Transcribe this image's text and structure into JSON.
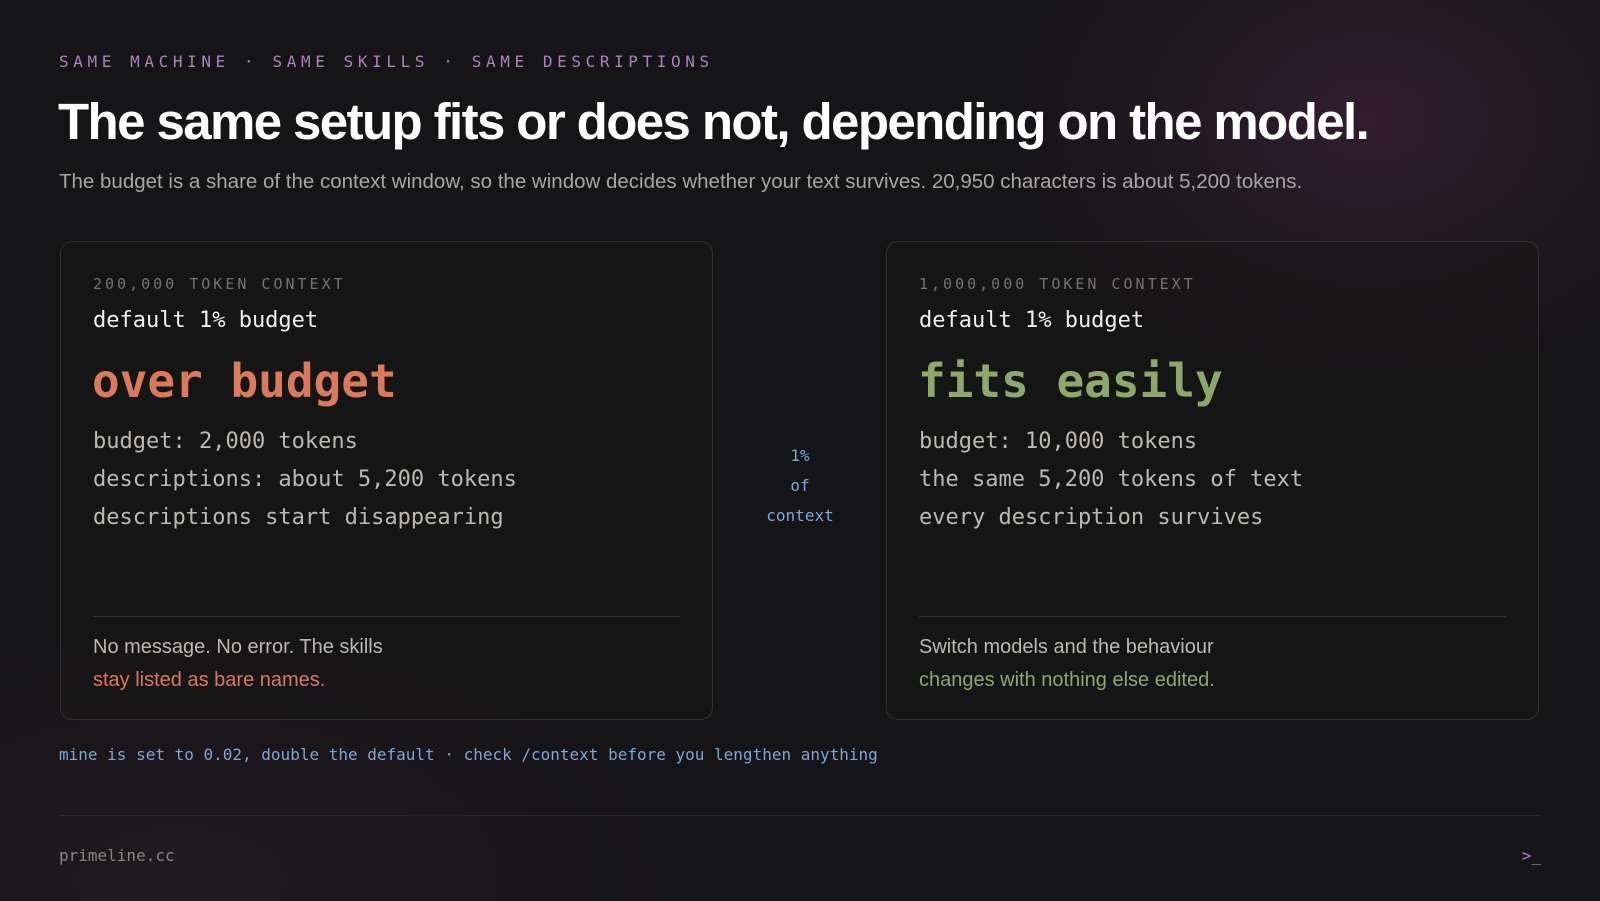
{
  "kicker": "SAME MACHINE · SAME SKILLS · SAME DESCRIPTIONS",
  "headline": "The same setup fits or does not, depending on the model.",
  "subtitle": "The budget is a share of the context window, so the window decides whether your text survives. 20,950 characters is about 5,200 tokens.",
  "cards": [
    {
      "context_label": "200,000 TOKEN CONTEXT",
      "default_line": "default 1% budget",
      "verdict": "over budget",
      "stats": [
        "budget: 2,000 tokens",
        "descriptions: about 5,200 tokens",
        "descriptions start disappearing"
      ],
      "foot_line1": "No message. No error. The skills",
      "foot_line2": "stay listed as bare names."
    },
    {
      "context_label": "1,000,000 TOKEN CONTEXT",
      "default_line": "default 1% budget",
      "verdict": "fits easily",
      "stats": [
        "budget: 10,000 tokens",
        "the same 5,200 tokens of text",
        "every description survives"
      ],
      "foot_line1": "Switch models and the behaviour",
      "foot_line2": "changes with nothing else edited."
    }
  ],
  "middle_label": [
    "1%",
    "of",
    "context"
  ],
  "note": "mine is set to 0.02, double the default · check /context before you lengthen anything",
  "footer": {
    "site": "primeline.cc",
    "prompt": ">_"
  },
  "colors": {
    "background": "#151417",
    "kicker": "#b07fc1",
    "over_budget": "#d9795d",
    "fits": "#8ea76c",
    "note_blue": "#7ea6d6"
  }
}
